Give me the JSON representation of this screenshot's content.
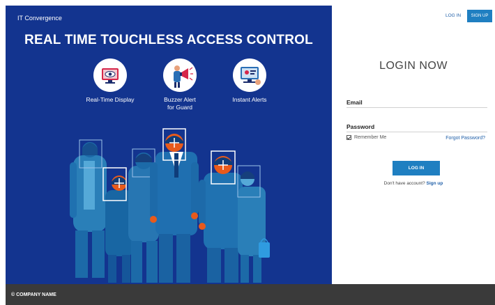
{
  "hero": {
    "brand": "IT Convergence",
    "title": "REAL TIME TOUCHLESS ACCESS CONTROL",
    "features": [
      {
        "label_line1": "Real-Time Display",
        "label_line2": "",
        "icon": "monitor-eye-icon"
      },
      {
        "label_line1": "Buzzer Alert",
        "label_line2": "for Guard",
        "icon": "megaphone-guard-icon"
      },
      {
        "label_line1": "Instant Alerts",
        "label_line2": "",
        "icon": "alert-display-icon"
      }
    ]
  },
  "nav": {
    "login": "LOG IN",
    "signup": "SIGN UP"
  },
  "login": {
    "heading": "LOGIN NOW",
    "email_label": "Email",
    "email_value": "",
    "password_label": "Password",
    "password_value": "",
    "remember_label": "Remember Me",
    "remember_checked": true,
    "forgot": "Forgot Password?",
    "button": "LOG IN",
    "no_account": "Don't have account?",
    "signup_link": "Sign up"
  },
  "footer": {
    "company": "© COMPANY NAME"
  },
  "colors": {
    "hero_bg": "#13348f",
    "accent": "#1f7fc1",
    "link": "#1f5fa8",
    "footer_bg": "#3a3a3a"
  }
}
